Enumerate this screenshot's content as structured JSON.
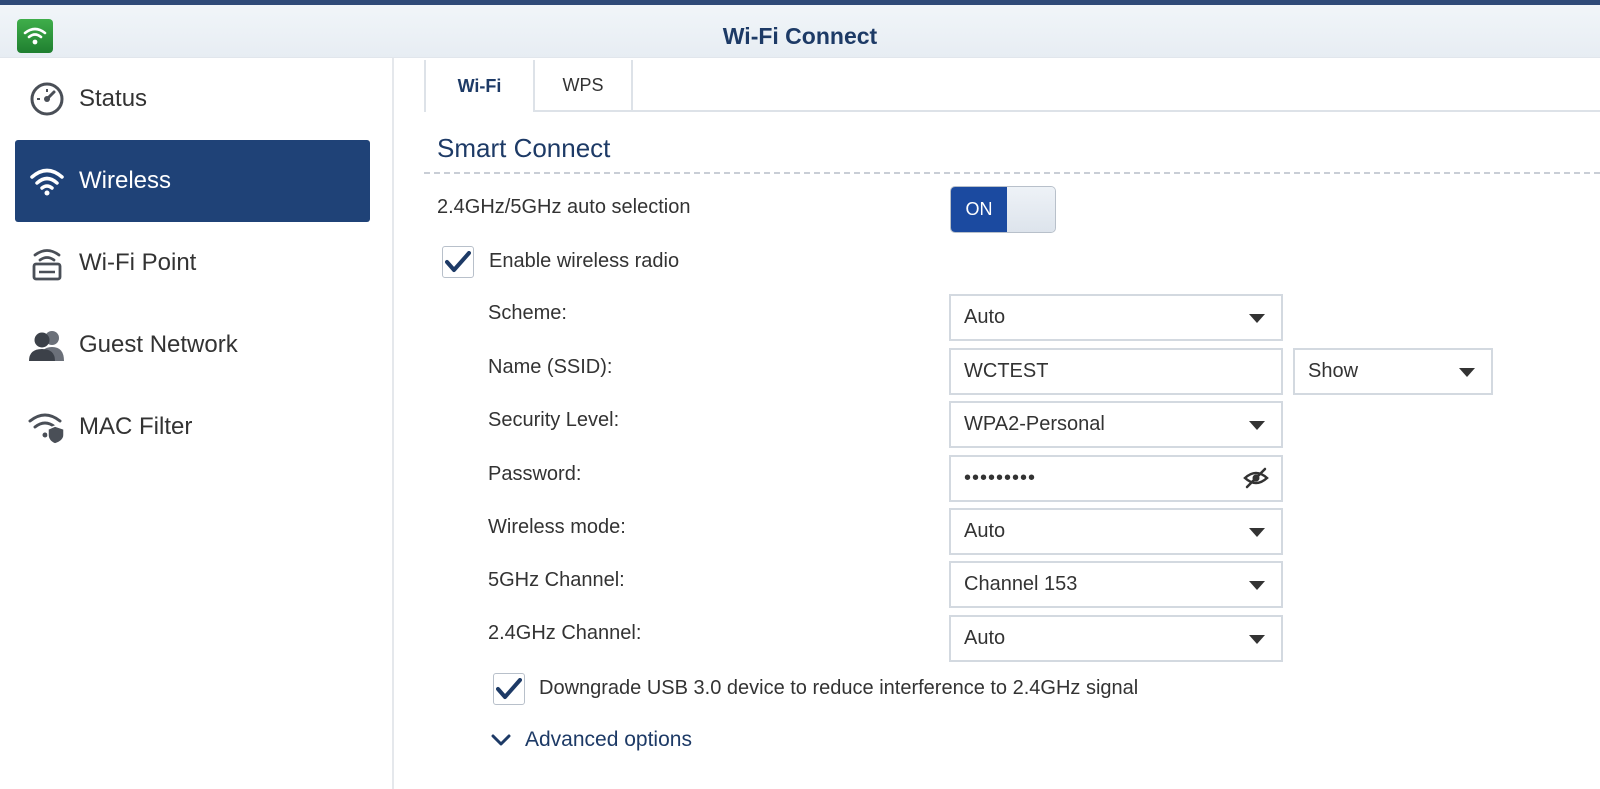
{
  "window": {
    "title": "Wi-Fi Connect",
    "app_icon": "wifi-app-icon"
  },
  "sidebar": {
    "items": [
      {
        "label": "Status",
        "icon": "gauge-icon",
        "active": false
      },
      {
        "label": "Wireless",
        "icon": "wifi-icon",
        "active": true
      },
      {
        "label": "Wi-Fi Point",
        "icon": "wifi-point-icon",
        "active": false
      },
      {
        "label": "Guest Network",
        "icon": "guest-users-icon",
        "active": false
      },
      {
        "label": "MAC Filter",
        "icon": "wifi-shield-icon",
        "active": false
      }
    ]
  },
  "tabs": [
    {
      "label": "Wi-Fi",
      "active": true
    },
    {
      "label": "WPS",
      "active": false
    }
  ],
  "section": {
    "title": "Smart Connect"
  },
  "smart_connect": {
    "label": "2.4GHz/5GHz auto selection",
    "toggle_label": "ON",
    "enabled": true
  },
  "enable_radio": {
    "label": "Enable wireless radio",
    "checked": true
  },
  "form": {
    "scheme": {
      "label": "Scheme:",
      "value": "Auto"
    },
    "ssid": {
      "label": "Name (SSID):",
      "value": "WCTEST",
      "visibility": "Show"
    },
    "security": {
      "label": "Security Level:",
      "value": "WPA2-Personal"
    },
    "password": {
      "label": "Password:",
      "value": "•••••••••"
    },
    "wireless_mode": {
      "label": "Wireless mode:",
      "value": "Auto"
    },
    "channel_5g": {
      "label": "5GHz Channel:",
      "value": "Channel 153"
    },
    "channel_24g": {
      "label": "2.4GHz Channel:",
      "value": "Auto"
    }
  },
  "usb_downgrade": {
    "label": "Downgrade USB 3.0 device to reduce interference to 2.4GHz signal",
    "checked": true
  },
  "advanced": {
    "label": "Advanced options"
  },
  "colors": {
    "accent": "#1f4277",
    "toggle_on": "#1b4aa0",
    "title_text": "#1d3a66"
  }
}
